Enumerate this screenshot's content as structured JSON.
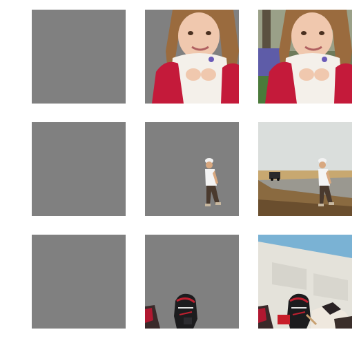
{
  "grid": {
    "rows": [
      {
        "tiles": [
          {
            "kind": "blank",
            "icon": "gray-square"
          },
          {
            "kind": "masked",
            "icon": "girl-photo-masked"
          },
          {
            "kind": "photo",
            "icon": "girl-photo"
          }
        ]
      },
      {
        "tiles": [
          {
            "kind": "blank",
            "icon": "gray-square"
          },
          {
            "kind": "masked",
            "icon": "walking-man-photo-masked"
          },
          {
            "kind": "photo",
            "icon": "walking-man-photo"
          }
        ]
      },
      {
        "tiles": [
          {
            "kind": "blank",
            "icon": "gray-square"
          },
          {
            "kind": "masked",
            "icon": "motorcycle-rider-photo-masked"
          },
          {
            "kind": "photo",
            "icon": "motorcycle-rider-photo"
          }
        ]
      }
    ]
  },
  "colors": {
    "mask_gray": "#808080",
    "background": "#ffffff"
  }
}
